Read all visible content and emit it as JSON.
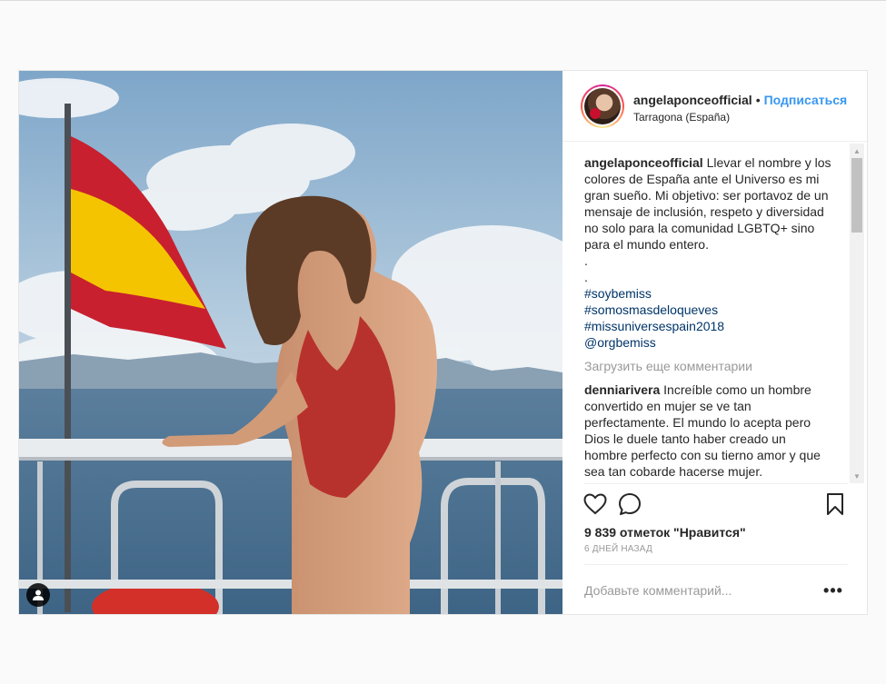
{
  "post": {
    "username": "angelaponceofficial",
    "separator": "•",
    "follow_label": "Подписаться",
    "location": "Tarragona (España)",
    "caption_username": "angelaponceofficial",
    "caption_lines": [
      "Llevar el nombre y los",
      "colores de España ante el Universo es mi",
      "gran sueño. Mi objetivo: ser portavoz de un",
      "mensaje de inclusión, respeto y diversidad",
      "no solo para la comunidad LGBTQ+ sino",
      "para el mundo entero.",
      ".",
      "."
    ],
    "hashtags": [
      "#soybemiss",
      "#somosmasdeloqueves",
      "#missuniversespain2018",
      "@orgbemiss"
    ],
    "load_more_label": "Загрузить еще комментарии",
    "comment": {
      "username": "denniarivera",
      "lines": [
        "Increíble como un hombre",
        "convertido en mujer se ve tan",
        "perfectamente. El mundo lo acepta pero",
        "Dios le duele tanto haber creado un",
        "hombre perfecto con su tierno amor y que",
        "sea tan cobarde hacerse mujer."
      ]
    },
    "likes_text": "9 839 отметок \"Нравится\"",
    "time_ago": "6 ДНЕЙ НАЗАД",
    "comment_placeholder": "Добавьте комментарий...",
    "more_label": "•••"
  },
  "icons": {
    "like": "heart-icon",
    "comment": "comment-bubble-icon",
    "save": "bookmark-icon",
    "tag": "user-tag-icon",
    "scroll_up": "scroll-up-arrow-icon",
    "scroll_down": "scroll-down-arrow-icon"
  },
  "colors": {
    "link": "#3897f0",
    "hashtag": "#003569",
    "muted": "#999999",
    "text": "#262626",
    "flag_red": "#c8202f",
    "flag_yellow": "#f5c400",
    "swimsuit": "#b8322d"
  }
}
